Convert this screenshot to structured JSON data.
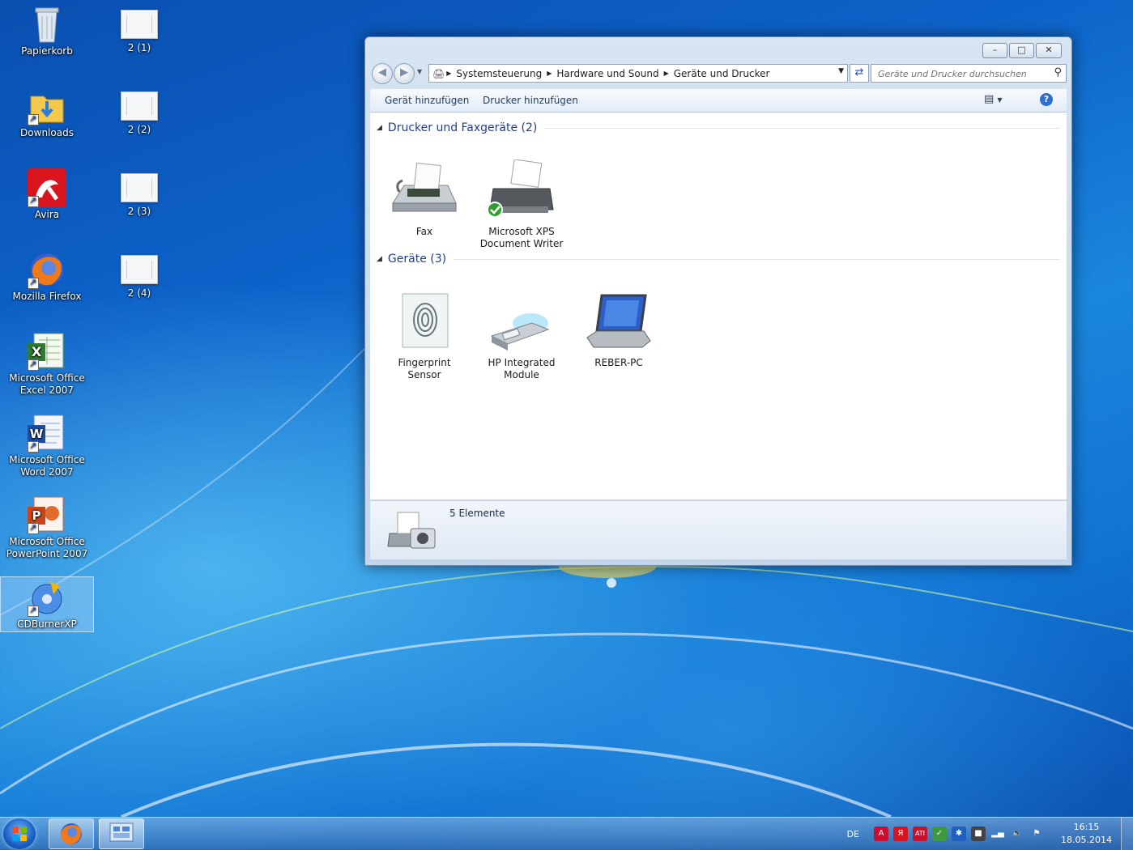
{
  "desktop": {
    "icons": [
      {
        "label": "Papierkorb",
        "icon": "recycle-bin-icon"
      },
      {
        "label": "Downloads",
        "icon": "downloads-folder-icon"
      },
      {
        "label": "Avira",
        "icon": "avira-icon"
      },
      {
        "label": "Mozilla Firefox",
        "icon": "firefox-icon"
      },
      {
        "label": "Microsoft Office Excel 2007",
        "icon": "excel-icon"
      },
      {
        "label": "Microsoft Office Word 2007",
        "icon": "word-icon"
      },
      {
        "label": "Microsoft Office PowerPoint 2007",
        "icon": "powerpoint-icon"
      },
      {
        "label": "CDBurnerXP",
        "icon": "cdburnerxp-icon"
      }
    ],
    "files": [
      {
        "label": "2 (1)"
      },
      {
        "label": "2 (2)"
      },
      {
        "label": "2 (3)"
      },
      {
        "label": "2 (4)"
      }
    ]
  },
  "window": {
    "breadcrumb": [
      "Systemsteuerung",
      "Hardware und Sound",
      "Geräte und Drucker"
    ],
    "search_placeholder": "Geräte und Drucker durchsuchen",
    "toolbar": {
      "add_device": "Gerät hinzufügen",
      "add_printer": "Drucker hinzufügen"
    },
    "groups": [
      {
        "title": "Drucker und Faxgeräte (2)",
        "items": [
          {
            "label": "Fax",
            "icon": "fax-icon"
          },
          {
            "label": "Microsoft XPS Document Writer",
            "icon": "printer-icon"
          }
        ]
      },
      {
        "title": "Geräte (3)",
        "items": [
          {
            "label": "Fingerprint Sensor",
            "icon": "fingerprint-icon"
          },
          {
            "label": "HP Integrated Module",
            "icon": "usb-module-icon"
          },
          {
            "label": "REBER-PC",
            "icon": "laptop-icon"
          }
        ]
      }
    ],
    "details": {
      "count": "5 Elemente"
    }
  },
  "taskbar": {
    "language": "DE",
    "time": "16:15",
    "date": "18.05.2014"
  }
}
